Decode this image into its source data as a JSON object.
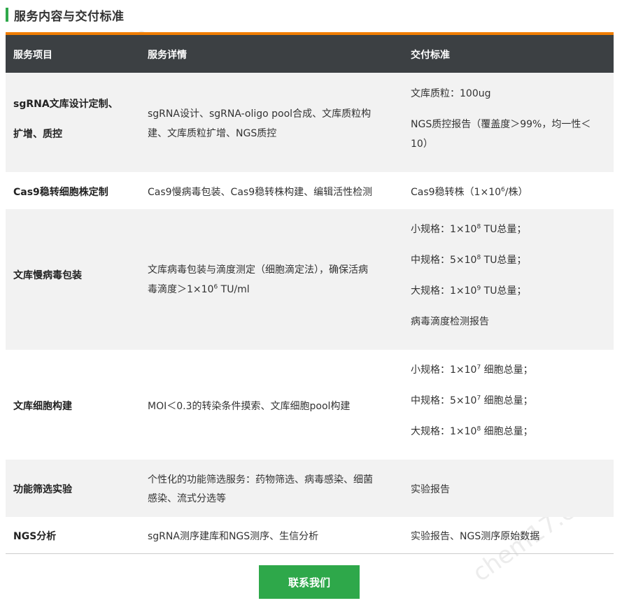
{
  "section": {
    "title": "服务内容与交付标准"
  },
  "table": {
    "headers": [
      "服务项目",
      "服务详情",
      "交付标准"
    ],
    "rows": [
      {
        "item_lines": [
          "sgRNA文库设计定制、",
          "扩增、质控"
        ],
        "detail_lines": [
          "sgRNA设计、sgRNA-oligo pool合成、文库质粒构",
          "建、文库质粒扩增、NGS质控"
        ],
        "delivery": [
          "文库质粒：100ug",
          "NGS质控报告（覆盖度＞99%，均一性＜",
          "10）"
        ]
      },
      {
        "item_lines": [
          "Cas9稳转细胞株定制"
        ],
        "detail_lines": [
          "Cas9慢病毒包装、Cas9稳转株构建、编辑活性检测"
        ],
        "delivery_pre": "Cas9稳转株（1×10",
        "delivery_sup": "6",
        "delivery_post": "/株）"
      },
      {
        "item_lines": [
          "文库慢病毒包装"
        ],
        "detail_line1": "文库病毒包装与滴度测定（细胞滴定法），确保活病",
        "detail_pre": "毒滴度＞1×10",
        "detail_sup": "6",
        "detail_post": " TU/ml",
        "delivery": [
          {
            "pre": "小规格：1×10",
            "sup": "8",
            "post": " TU总量；"
          },
          {
            "pre": "中规格：5×10",
            "sup": "8",
            "post": " TU总量；"
          },
          {
            "pre": "大规格：1×10",
            "sup": "9",
            "post": " TU总量；"
          }
        ],
        "delivery_last": "病毒滴度检测报告"
      },
      {
        "item_lines": [
          "文库细胞构建"
        ],
        "detail_lines": [
          "MOI＜0.3的转染条件摸索、文库细胞pool构建"
        ],
        "delivery": [
          {
            "pre": "小规格：1×10",
            "sup": "7",
            "post": " 细胞总量；"
          },
          {
            "pre": "中规格：5×10",
            "sup": "7",
            "post": " 细胞总量；"
          },
          {
            "pre": "大规格：1×10",
            "sup": "8",
            "post": " 细胞总量；"
          }
        ]
      },
      {
        "item_lines": [
          "功能筛选实验"
        ],
        "detail_lines": [
          "个性化的功能筛选服务：药物筛选、病毒感染、细菌",
          "感染、流式分选等"
        ],
        "delivery": [
          "实验报告"
        ]
      },
      {
        "item_lines": [
          "NGS分析"
        ],
        "detail_lines": [
          "sgRNA测序建库和NGS测序、生信分析"
        ],
        "delivery": [
          "实验报告、NGS测序原始数据"
        ]
      }
    ]
  },
  "contact_button": {
    "label": "联系我们"
  },
  "watermarks": [
    "chem17.com",
    "chem17.com"
  ],
  "colors": {
    "accent_green": "#2ea84a",
    "accent_orange": "#f07d00",
    "header_bg": "#3c4043"
  }
}
